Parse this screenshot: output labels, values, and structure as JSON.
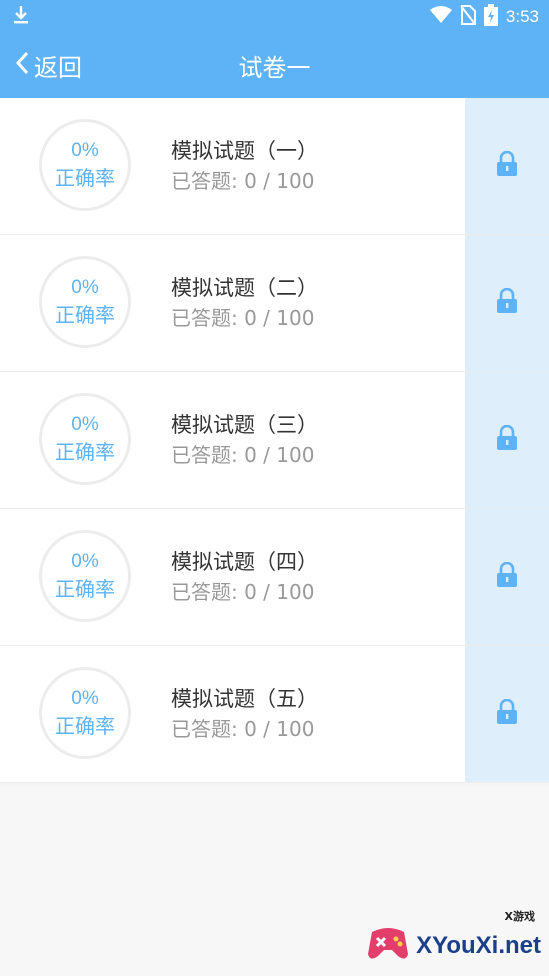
{
  "status_bar": {
    "time": "3:53",
    "icons": [
      "download-icon",
      "wifi-icon",
      "no-sim-icon",
      "battery-charging-icon"
    ]
  },
  "app_bar": {
    "back_label": "返回",
    "title": "试卷一"
  },
  "exams": [
    {
      "percent": "0%",
      "rate_label": "正确率",
      "name": "模拟试题（一）",
      "answered": "已答题: 0 / 100",
      "locked": true
    },
    {
      "percent": "0%",
      "rate_label": "正确率",
      "name": "模拟试题（二）",
      "answered": "已答题: 0 / 100",
      "locked": true
    },
    {
      "percent": "0%",
      "rate_label": "正确率",
      "name": "模拟试题（三）",
      "answered": "已答题: 0 / 100",
      "locked": true
    },
    {
      "percent": "0%",
      "rate_label": "正确率",
      "name": "模拟试题（四）",
      "answered": "已答题: 0 / 100",
      "locked": true
    },
    {
      "percent": "0%",
      "rate_label": "正确率",
      "name": "模拟试题（五）",
      "answered": "已答题: 0 / 100",
      "locked": true
    }
  ],
  "watermark": {
    "brand": "XYouXi.net",
    "tag": "X游戏"
  },
  "colors": {
    "accent": "#5db3f5",
    "lock_bg": "#deeefb"
  }
}
